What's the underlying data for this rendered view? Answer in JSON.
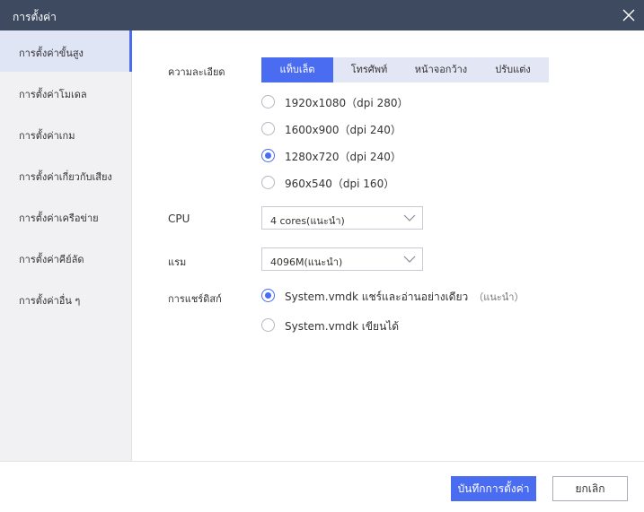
{
  "window": {
    "title": "การตั้งค่า",
    "close_icon": "close-icon"
  },
  "sidebar": {
    "items": [
      {
        "label": "การตั้งค่าขั้นสูง",
        "active": true
      },
      {
        "label": "การตั้งค่าโมเดล"
      },
      {
        "label": "การตั้งค่าเกม"
      },
      {
        "label": "การตั้งค่าเกี่ยวกับเสียง"
      },
      {
        "label": "การตั้งค่าเครือข่าย"
      },
      {
        "label": "การตั้งค่าคีย์ลัด"
      },
      {
        "label": "การตั้งค่าอื่น ๆ"
      }
    ]
  },
  "resolution": {
    "label": "ความละเอียด",
    "tabs": [
      {
        "label": "แท็บเล็ต",
        "active": true
      },
      {
        "label": "โทรศัพท์"
      },
      {
        "label": "หน้าจอกว้าง"
      },
      {
        "label": "ปรับแต่ง"
      }
    ],
    "options": [
      {
        "label": "1920x1080（dpi 280）",
        "checked": false
      },
      {
        "label": "1600x900（dpi 240）",
        "checked": false
      },
      {
        "label": "1280x720（dpi 240）",
        "checked": true
      },
      {
        "label": "960x540（dpi 160）",
        "checked": false
      }
    ]
  },
  "cpu": {
    "label": "CPU",
    "value": "4 cores(แนะนำ)"
  },
  "ram": {
    "label": "แรม",
    "value": "4096M(แนะนำ)"
  },
  "disk": {
    "label": "การแชร์ดิสก์",
    "options": [
      {
        "label": "System.vmdk แชร์และอ่านอย่างเดียว",
        "note": "（แนะนำ）",
        "checked": true
      },
      {
        "label": "System.vmdk เขียนได้",
        "note": "",
        "checked": false
      }
    ]
  },
  "footer": {
    "save_label": "บันทึกการตั้งค่า",
    "cancel_label": "ยกเลิก"
  },
  "colors": {
    "accent": "#4a6cf0",
    "titlebar": "#3d4a5f",
    "sidebar_bg": "#f1f1f3"
  }
}
